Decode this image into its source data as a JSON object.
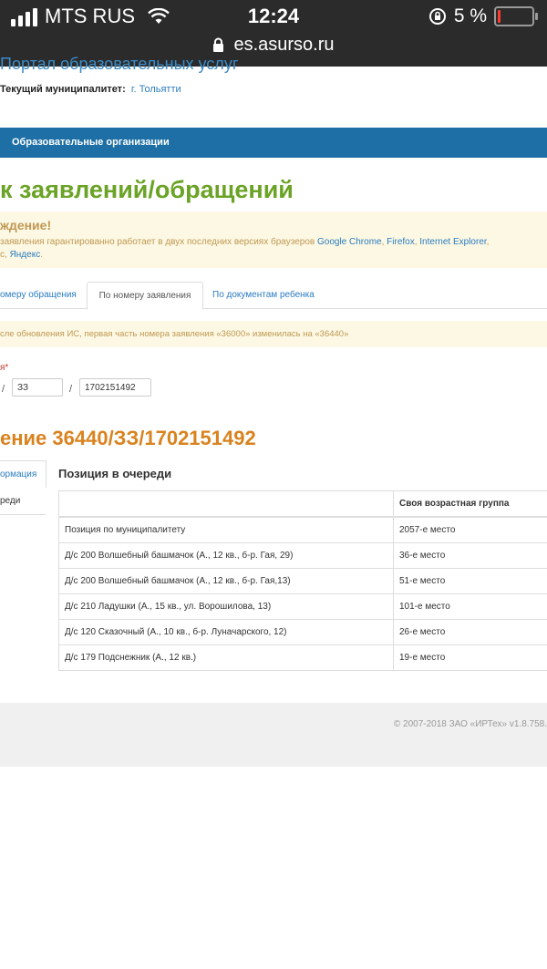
{
  "status_bar": {
    "carrier": "MTS RUS",
    "time": "12:24",
    "battery": "5 %",
    "url": "es.asurso.ru",
    "icons": [
      "signal-icon",
      "wifi-icon",
      "orientation-lock-icon",
      "battery-icon",
      "lock-icon"
    ]
  },
  "header": {
    "portal_title": "Портал образовательных услуг",
    "municipality_label": "Текущий муниципалитет:",
    "municipality_value": "г. Тольятти"
  },
  "nav": {
    "item": "Образовательные организации"
  },
  "page": {
    "title": "к заявлений/обращений"
  },
  "warning": {
    "title": "ждение!",
    "text": "заявления гарантированно работает в двух последних версиях браузеров",
    "browsers": [
      "Google Chrome",
      "Firefox",
      "Internet Explorer",
      "Яндекс"
    ],
    "sep1": ", ",
    "sep2": ", ",
    "sep3": ",",
    "pre_last": "c, ",
    "end": "."
  },
  "tabs": [
    {
      "label": "омеру обращения"
    },
    {
      "label": "По номеру заявления",
      "active": true
    },
    {
      "label": "По документам ребенка"
    }
  ],
  "info": {
    "text": "сле обновления ИС, первая часть номера заявления «36000» изменилась на «36440»"
  },
  "form": {
    "label": "я",
    "required_mark": "*",
    "sep": "/",
    "part2": "ЗЗ",
    "part3": "1702151492"
  },
  "application": {
    "title": "ение 36440/ЗЗ/1702151492"
  },
  "side_nav": [
    {
      "label": "ормация",
      "active": true
    },
    {
      "label": "реди"
    }
  ],
  "queue": {
    "title": "Позиция в очереди",
    "header": [
      "",
      "Своя возрастная группа"
    ],
    "rows": [
      {
        "name": "Позиция по муниципалитету",
        "value": "2057-е место"
      },
      {
        "name": "Д/с 200 Волшебный башмачок (А., 12 кв., б-р. Гая, 29)",
        "value": "36-е место"
      },
      {
        "name": "Д/с 200 Волшебный башмачок (А., 12 кв., б-р. Гая,13)",
        "value": "51-е место"
      },
      {
        "name": "Д/с 210 Ладушки (А., 15 кв., ул. Ворошилова, 13)",
        "value": "101-е место"
      },
      {
        "name": "Д/с 120 Сказочный (А., 10 кв., б-р. Луначарского, 12)",
        "value": "26-е место"
      },
      {
        "name": "Д/с 179 Подснежник (А., 12 кв.)",
        "value": "19-е место"
      }
    ]
  },
  "footer": {
    "text": "© 2007-2018 ЗАО «ИРТех» v1.8.758."
  },
  "colors": {
    "nav_bar": "#1d6fa5",
    "page_title": "#6aa325",
    "application_title": "#d9831f",
    "warning_bg": "#fcf8e3",
    "link": "#2a7cc0"
  }
}
